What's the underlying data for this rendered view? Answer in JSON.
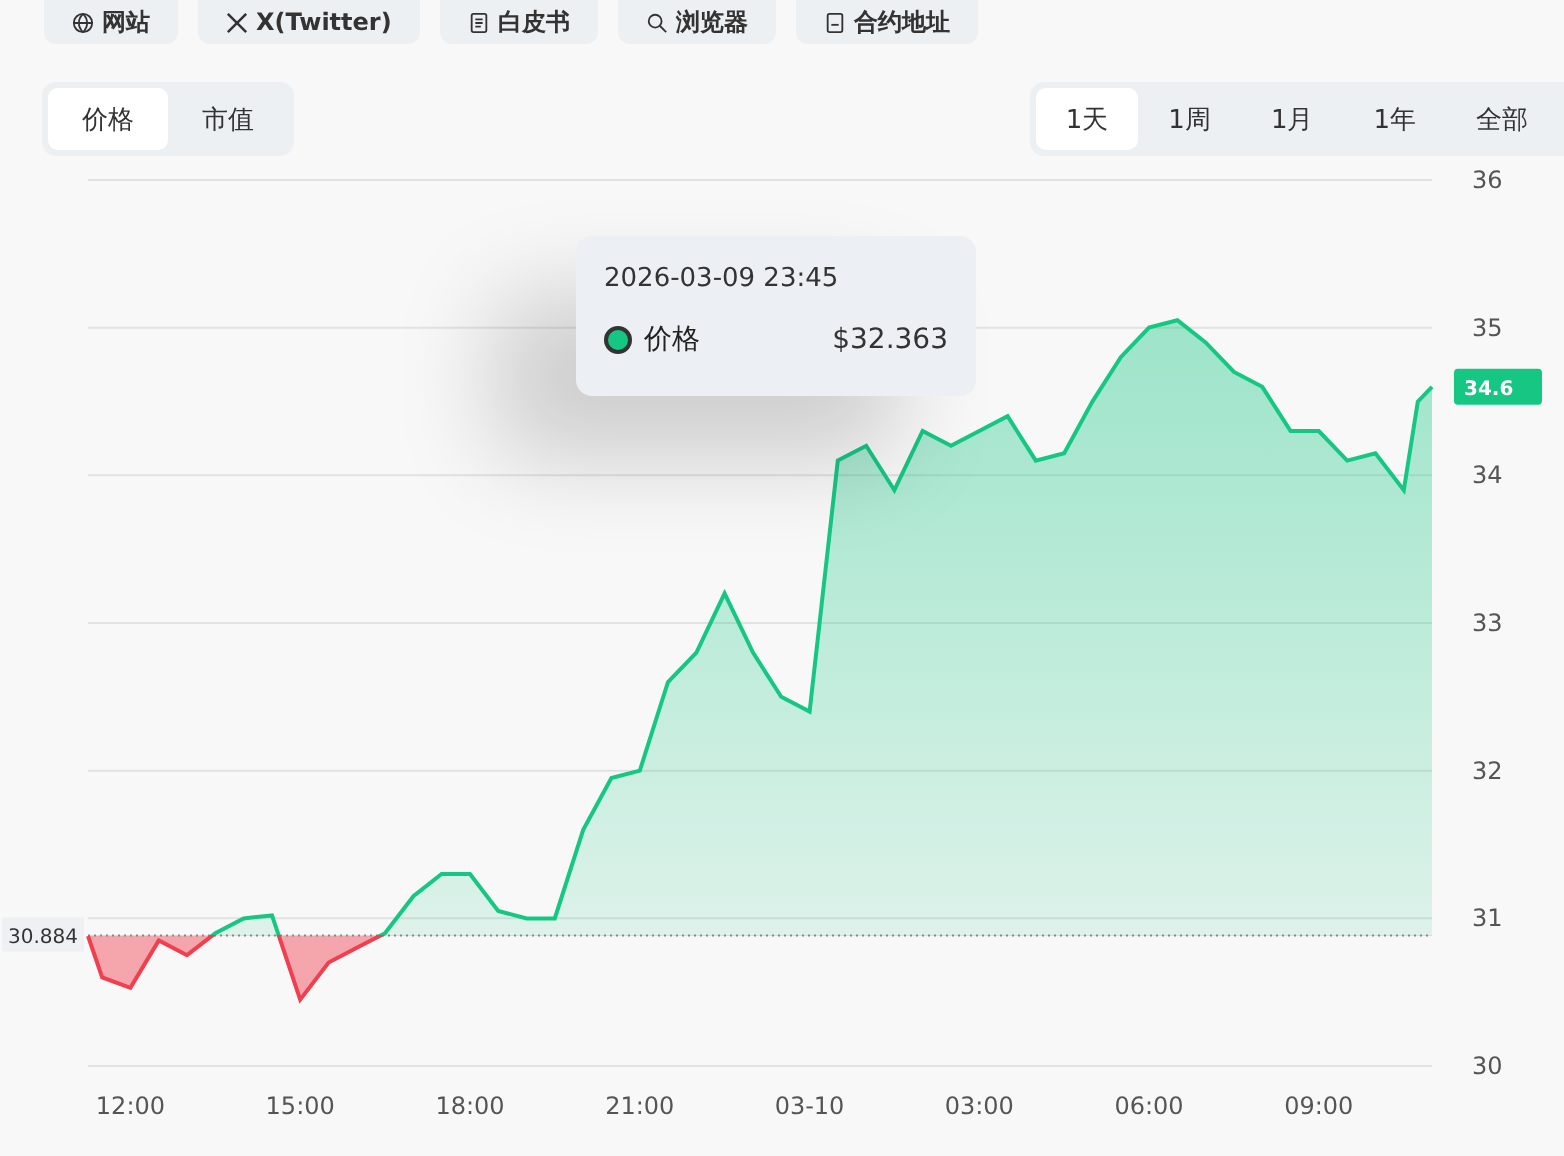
{
  "links": [
    {
      "label": "网站",
      "kind": "globe"
    },
    {
      "label": "X(Twitter)",
      "kind": "x"
    },
    {
      "label": "白皮书",
      "kind": "doc"
    },
    {
      "label": "浏览器",
      "kind": "search"
    },
    {
      "label": "合约地址",
      "kind": "contract"
    }
  ],
  "metric_tabs": [
    {
      "label": "价格",
      "selected": true
    },
    {
      "label": "市值",
      "selected": false
    }
  ],
  "range_tabs": [
    {
      "label": "1天",
      "selected": true
    },
    {
      "label": "1周",
      "selected": false
    },
    {
      "label": "1月",
      "selected": false
    },
    {
      "label": "1年",
      "selected": false
    },
    {
      "label": "全部",
      "selected": false
    }
  ],
  "chart": {
    "last_price_label": "34.6",
    "tooltip": {
      "time": "2026-03-09 23:45",
      "value": "$32.363"
    },
    "chart_data": {
      "type": "area",
      "x": [
        "2026-03-09 11:15",
        "2026-03-09 11:30",
        "2026-03-09 12:00",
        "2026-03-09 12:30",
        "2026-03-09 13:00",
        "2026-03-09 13:30",
        "2026-03-09 14:00",
        "2026-03-09 14:30",
        "2026-03-09 15:00",
        "2026-03-09 15:30",
        "2026-03-09 16:00",
        "2026-03-09 16:30",
        "2026-03-09 17:00",
        "2026-03-09 17:30",
        "2026-03-09 18:00",
        "2026-03-09 18:30",
        "2026-03-09 19:00",
        "2026-03-09 19:30",
        "2026-03-09 20:00",
        "2026-03-09 20:30",
        "2026-03-09 21:00",
        "2026-03-09 21:30",
        "2026-03-09 22:00",
        "2026-03-09 22:30",
        "2026-03-09 23:00",
        "2026-03-09 23:30",
        "2026-03-10 00:00",
        "2026-03-10 00:30",
        "2026-03-10 01:00",
        "2026-03-10 01:30",
        "2026-03-10 02:00",
        "2026-03-10 02:30",
        "2026-03-10 03:00",
        "2026-03-10 03:30",
        "2026-03-10 04:00",
        "2026-03-10 04:30",
        "2026-03-10 05:00",
        "2026-03-10 05:30",
        "2026-03-10 06:00",
        "2026-03-10 06:30",
        "2026-03-10 07:00",
        "2026-03-10 07:30",
        "2026-03-10 08:00",
        "2026-03-10 08:30",
        "2026-03-10 09:00",
        "2026-03-10 09:30",
        "2026-03-10 10:00",
        "2026-03-10 10:30",
        "2026-03-10 10:45",
        "2026-03-10 11:00"
      ],
      "series": [
        {
          "name": "价格",
          "color": "#16c784",
          "values": [
            30.88,
            30.6,
            30.53,
            30.85,
            30.75,
            30.9,
            31.0,
            31.02,
            30.45,
            30.7,
            30.8,
            30.9,
            31.15,
            31.3,
            31.3,
            31.05,
            31.0,
            31.0,
            31.6,
            31.95,
            32.0,
            32.6,
            32.8,
            33.2,
            32.8,
            32.5,
            32.4,
            34.1,
            34.2,
            33.9,
            34.3,
            34.2,
            34.3,
            34.4,
            34.1,
            34.15,
            34.5,
            34.8,
            35.0,
            35.05,
            34.9,
            34.7,
            34.6,
            34.3,
            34.3,
            34.1,
            34.15,
            33.9,
            34.5,
            34.6
          ]
        }
      ],
      "ylim": [
        30,
        36
      ],
      "xticks": [
        {
          "value": "2026-03-09 12:00",
          "label": "12:00"
        },
        {
          "value": "2026-03-09 15:00",
          "label": "15:00"
        },
        {
          "value": "2026-03-09 18:00",
          "label": "18:00"
        },
        {
          "value": "2026-03-09 21:00",
          "label": "21:00"
        },
        {
          "value": "2026-03-10 00:00",
          "label": "03-10"
        },
        {
          "value": "2026-03-10 03:00",
          "label": "03:00"
        },
        {
          "value": "2026-03-10 06:00",
          "label": "06:00"
        },
        {
          "value": "2026-03-10 09:00",
          "label": "09:00"
        }
      ],
      "yticks": [
        30,
        31,
        32,
        33,
        34,
        35,
        36
      ],
      "grid": true,
      "xlim": [
        "2026-03-09 11:15",
        "2026-03-10 11:00"
      ],
      "ref_lines": [
        {
          "axis": "y",
          "value": 30.884,
          "label": "30.884"
        }
      ]
    }
  }
}
